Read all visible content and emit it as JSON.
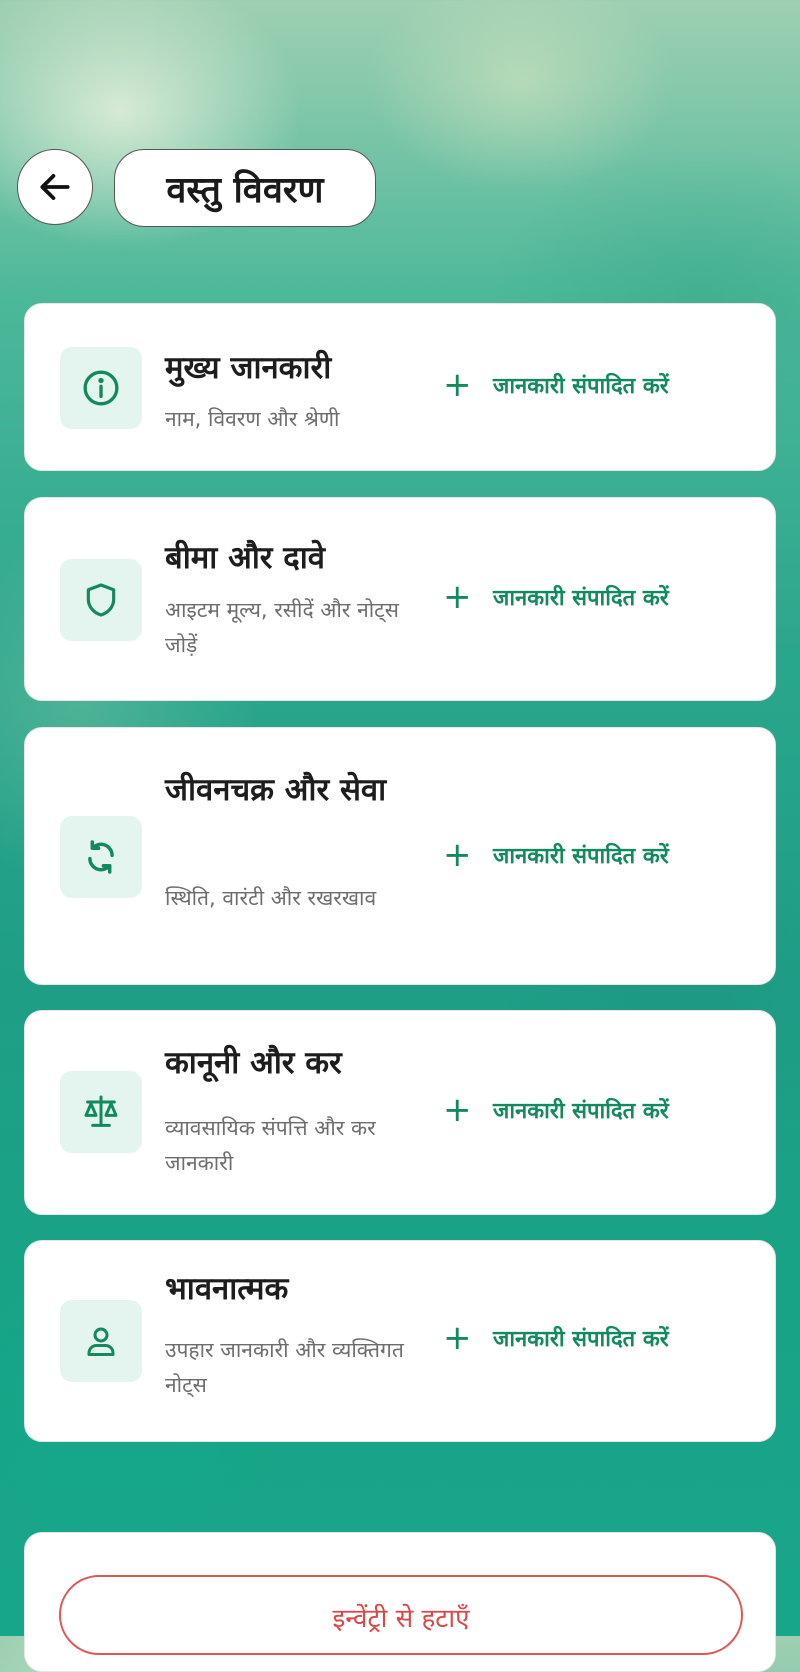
{
  "header": {
    "title": "वस्तु विवरण"
  },
  "sections": [
    {
      "title": "मुख्य जानकारी",
      "subtitle": "नाम, विवरण और श्रेणी",
      "action": "जानकारी संपादित करें",
      "icon": "info-icon"
    },
    {
      "title": "बीमा और दावे",
      "subtitle": "आइटम मूल्य, रसीदें और नोट्स जोड़ें",
      "action": "जानकारी संपादित करें",
      "icon": "shield-icon"
    },
    {
      "title": "जीवनचक्र और सेवा",
      "subtitle": "स्थिति, वारंटी और रखरखाव",
      "action": "जानकारी संपादित करें",
      "icon": "refresh-icon"
    },
    {
      "title": "कानूनी और कर",
      "subtitle": "व्यावसायिक संपत्ति और कर जानकारी",
      "action": "जानकारी संपादित करें",
      "icon": "scales-icon"
    },
    {
      "title": "भावनात्मक",
      "subtitle": "उपहार जानकारी और व्यक्तिगत नोट्स",
      "action": "जानकारी संपादित करें",
      "icon": "person-icon"
    }
  ],
  "footer": {
    "remove_label": "इन्वेंट्री से हटाएँ"
  },
  "colors": {
    "accent": "#138a5e",
    "icon_bg": "#e4f4ee",
    "danger": "#d94848"
  }
}
